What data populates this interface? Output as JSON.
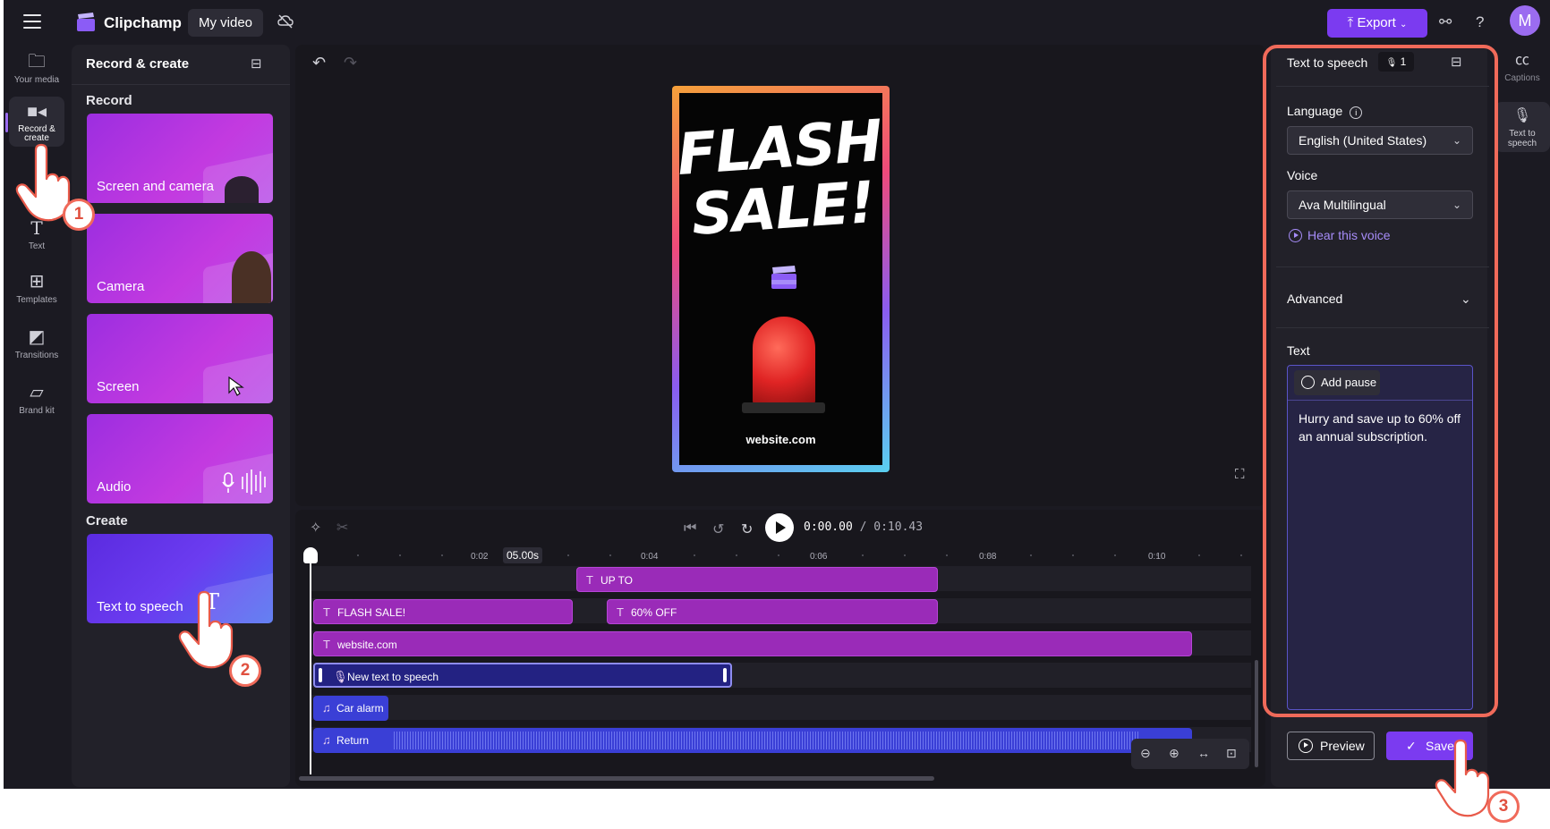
{
  "app": {
    "brand": "Clipchamp",
    "project_name": "My video",
    "export_label": "Export",
    "avatar_initial": "M",
    "accent_color": "#7b3bf0",
    "highlight_color": "#f06a5a"
  },
  "left_rail": [
    {
      "label": "Your media",
      "icon": "folder-icon"
    },
    {
      "label": "Record & create",
      "icon": "camera-icon",
      "active": true
    },
    {
      "label": "Text",
      "icon": "text-icon"
    },
    {
      "label": "Templates",
      "icon": "templates-icon"
    },
    {
      "label": "Transitions",
      "icon": "transitions-icon"
    },
    {
      "label": "Brand kit",
      "icon": "brand-kit-icon"
    }
  ],
  "record_panel": {
    "title": "Record & create",
    "record_section": "Record",
    "create_section": "Create",
    "cards": [
      {
        "label": "Screen and camera"
      },
      {
        "label": "Camera"
      },
      {
        "label": "Screen"
      },
      {
        "label": "Audio"
      },
      {
        "label": "Text to speech"
      }
    ]
  },
  "preview": {
    "headline_line1": "FLASH",
    "headline_line2": "SALE!",
    "website": "website.com"
  },
  "timeline": {
    "current_time": "0:00.00",
    "total_time": "/ 0:10.43",
    "cursor_label": "05.00s",
    "ticks": [
      "0:02",
      "0:04",
      "0:06",
      "0:08",
      "0:10"
    ],
    "clips": {
      "up_to": "UP TO",
      "flash_sale": "FLASH SALE!",
      "off": "60% OFF",
      "website": "website.com",
      "tts": "New text to speech",
      "car_alarm": "Car alarm",
      "return": "Return"
    }
  },
  "tts_panel": {
    "title": "Text to speech",
    "badge_count": "1",
    "language_label": "Language",
    "language_value": "English (United States)",
    "voice_label": "Voice",
    "voice_value": "Ava Multilingual",
    "hear_voice": "Hear this voice",
    "advanced_label": "Advanced",
    "text_label": "Text",
    "add_pause": "Add pause",
    "text_value": "Hurry and save up to 60% off an annual subscription.",
    "preview_label": "Preview",
    "save_label": "Save"
  },
  "right_rail": [
    {
      "label": "Captions",
      "icon": "captions-icon"
    },
    {
      "label": "Text to speech",
      "icon": "microphone-icon",
      "active": true
    }
  ],
  "steps": [
    "1",
    "2",
    "3"
  ]
}
